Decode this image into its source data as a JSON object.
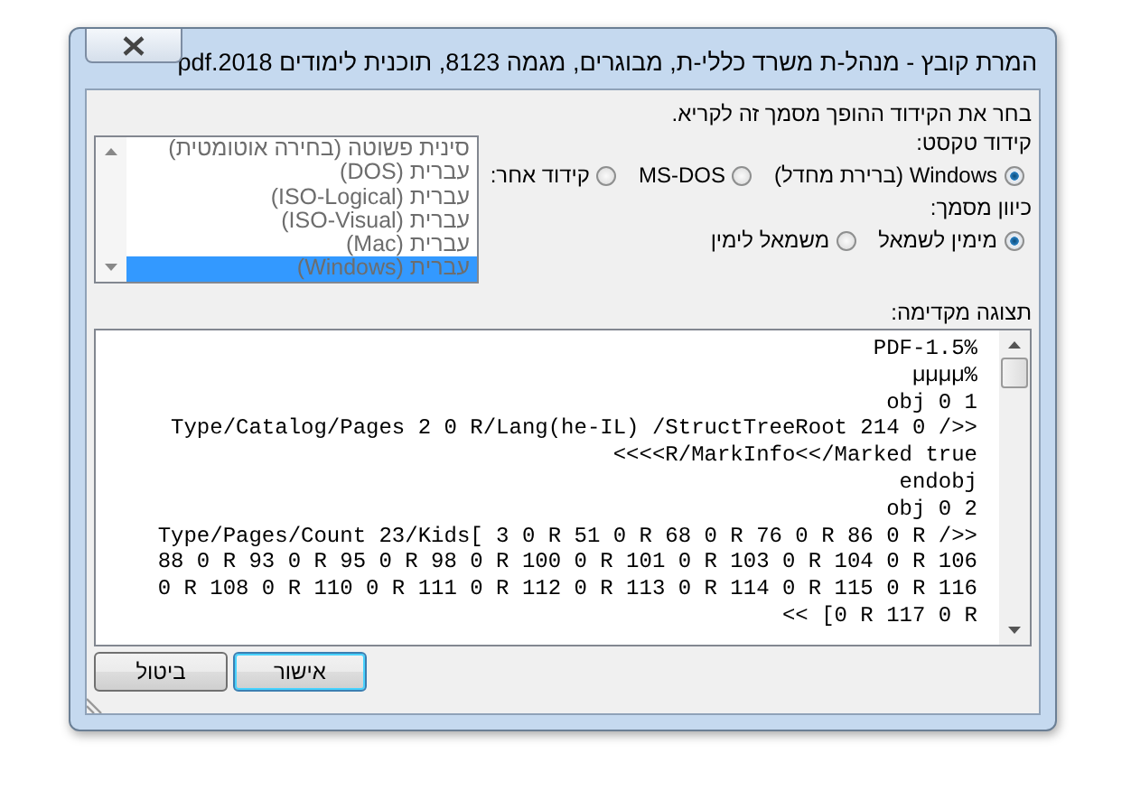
{
  "window": {
    "title": "המרת קובץ - מנהל-ת משרד כללי-ת, מבוגרים, מגמה 8123, תוכנית לימודים 2018.pdf"
  },
  "instruction": "בחר את הקידוד ההופך מסמך זה לקריא.",
  "encoding": {
    "label": "קידוד טקסט:",
    "options": [
      {
        "label": "Windows (ברירת מחדל)",
        "selected": true
      },
      {
        "label": "MS-DOS",
        "selected": false
      },
      {
        "label": "קידוד אחר:",
        "selected": false
      }
    ]
  },
  "direction": {
    "label": "כיוון מסמך:",
    "options": [
      {
        "label": "מימין לשמאל",
        "selected": true
      },
      {
        "label": "משמאל לימין",
        "selected": false
      }
    ]
  },
  "encoding_list": {
    "disabled": true,
    "items": [
      {
        "label": "סינית פשוטה (בחירה אוטומטית)",
        "selected": false
      },
      {
        "label": "עברית (DOS)",
        "selected": false
      },
      {
        "label": "עברית (ISO-Logical)",
        "selected": false
      },
      {
        "label": "עברית (ISO-Visual)",
        "selected": false
      },
      {
        "label": "עברית (Mac)",
        "selected": false
      },
      {
        "label": "עברית (Windows)",
        "selected": true
      }
    ]
  },
  "preview": {
    "label": "תצוגה מקדימה:",
    "lines": [
      "PDF-1.5%",
      "µµµµ%",
      "obj 0 1",
      "Type/Catalog/Pages 2 0 R/Lang(he-IL) /StructTreeRoot 214 0 />>",
      "<<<<R/MarkInfo<</Marked true",
      "endobj",
      "obj 0 2",
      "Type/Pages/Count 23/Kids[ 3 0 R 51 0 R 68 0 R 76 0 R 86 0 R />>",
      "88 0 R 93 0 R 95 0 R 98 0 R 100 0 R 101 0 R 103 0 R 104 0 R 106",
      "0 R 108 0 R 110 0 R 111 0 R 112 0 R 113 0 R 114 0 R 115 0 R 116",
      "<< [0 R 117 0 R"
    ]
  },
  "buttons": [
    {
      "label": "אישור",
      "default": true
    },
    {
      "label": "ביטול",
      "default": false
    }
  ]
}
